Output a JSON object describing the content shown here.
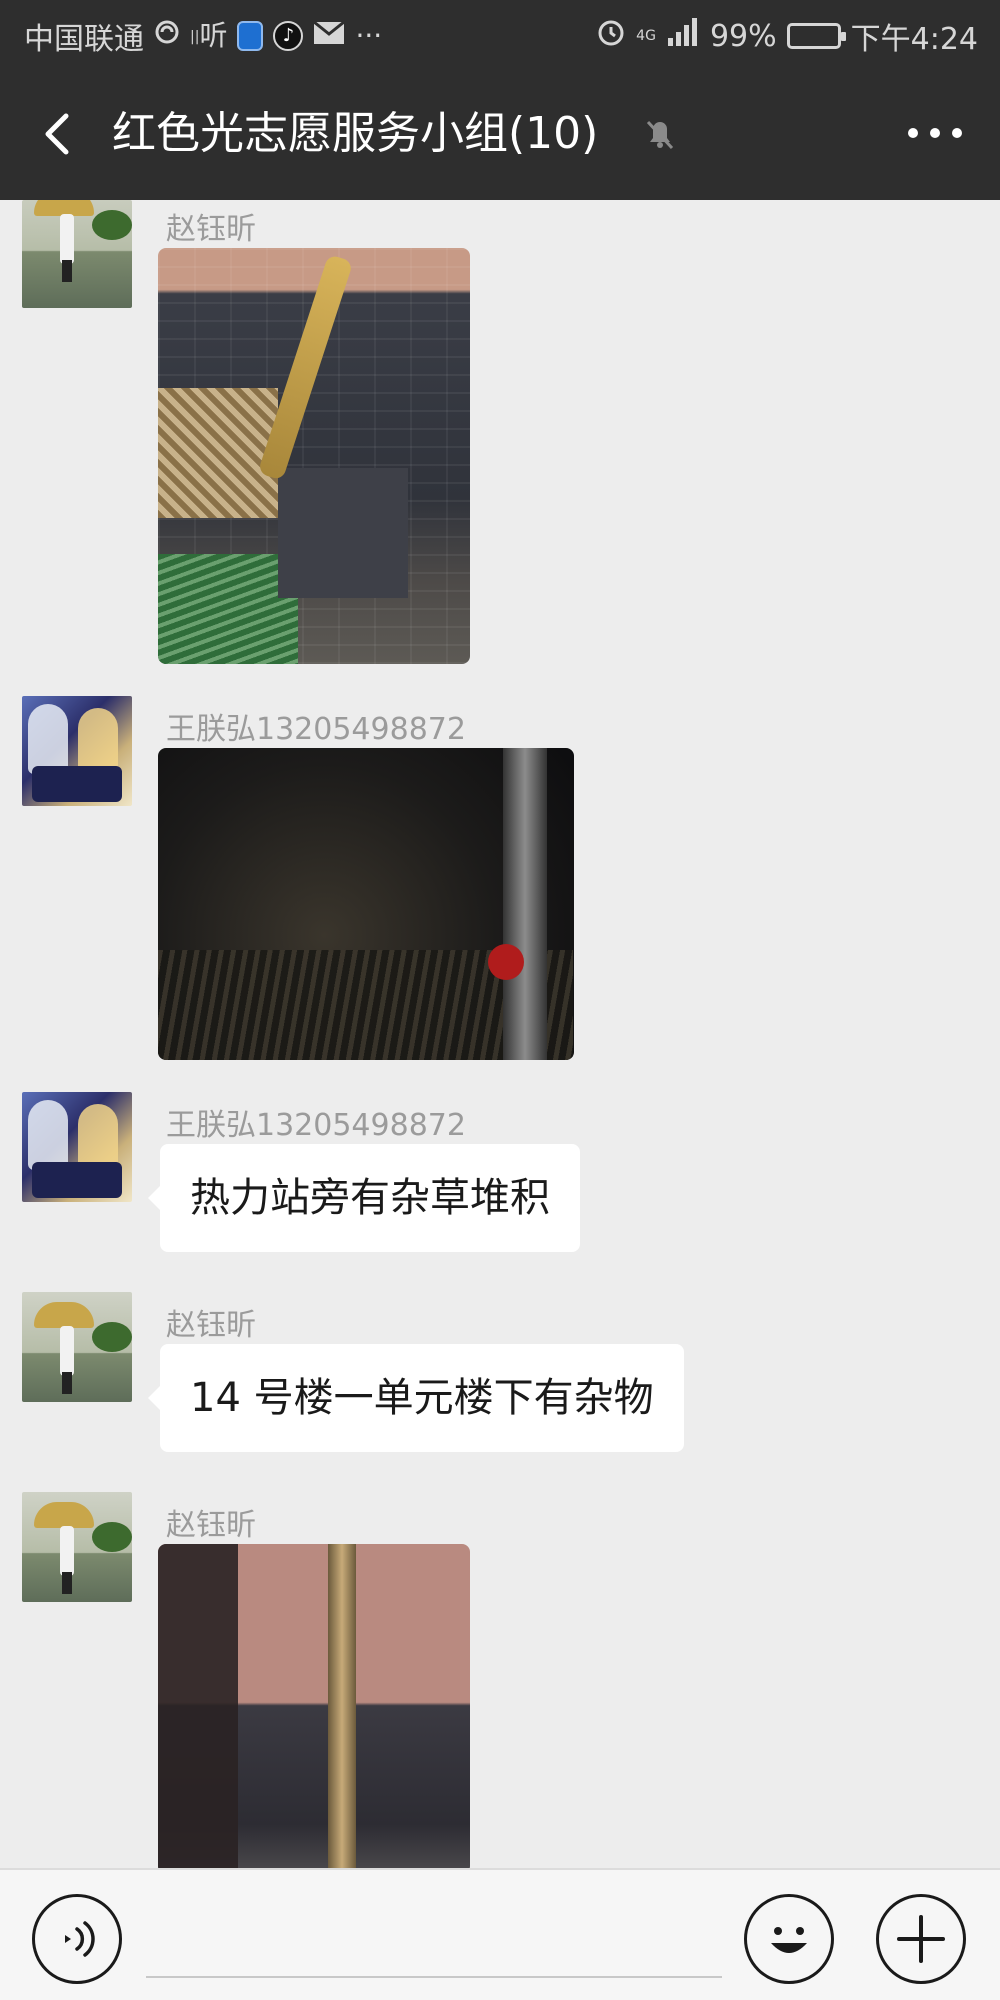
{
  "status_bar": {
    "carrier": "中国联通",
    "listen_label": "听",
    "more_dots": "···",
    "network": "4G",
    "battery": "99%",
    "battery_level": 0.99,
    "time": "下午4:24"
  },
  "header": {
    "title": "红色光志愿服务小组(10)",
    "back_icon": "chevron-left-icon",
    "mute_icon": "bell-off-icon",
    "more_icon": "more-dots-icon"
  },
  "messages": [
    {
      "sender": "赵钰昕",
      "type": "image",
      "avatar": "umbrella-person"
    },
    {
      "sender": "王朕弘13205498872",
      "type": "image",
      "avatar": "anime"
    },
    {
      "sender": "王朕弘13205498872",
      "type": "text",
      "text": "热力站旁有杂草堆积",
      "avatar": "anime"
    },
    {
      "sender": "赵钰昕",
      "type": "text",
      "text": "14 号楼一单元楼下有杂物",
      "avatar": "umbrella-person"
    },
    {
      "sender": "赵钰昕",
      "type": "image",
      "avatar": "umbrella-person"
    }
  ],
  "input_bar": {
    "voice_icon": "voice-icon",
    "emoji_icon": "emoji-icon",
    "plus_icon": "plus-icon",
    "input_value": ""
  }
}
